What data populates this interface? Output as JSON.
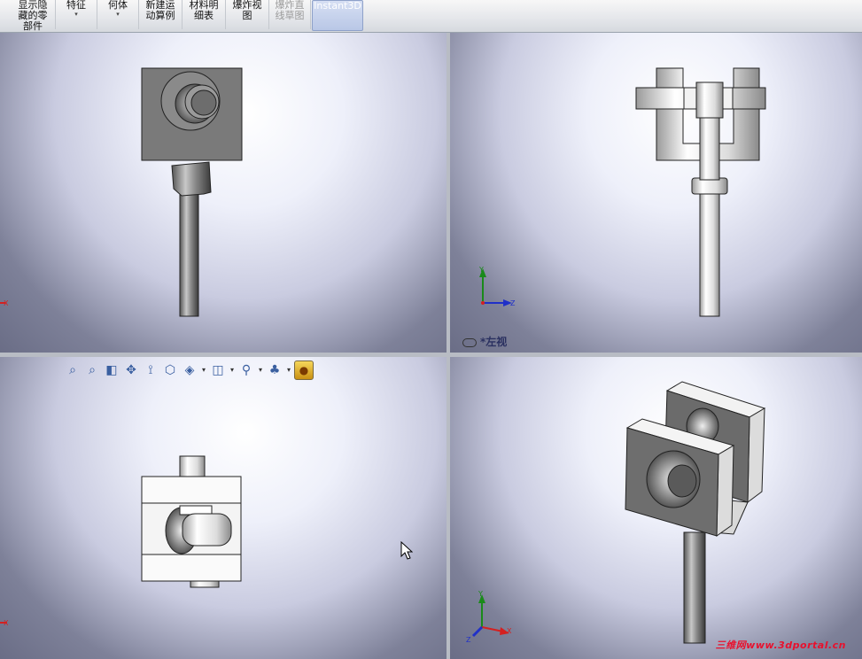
{
  "ribbon": {
    "buttons": [
      {
        "line1": "显示隐",
        "line2": "藏的零",
        "line3": "部件"
      },
      {
        "line1": "特征",
        "line2": "▾",
        "line3": ""
      },
      {
        "line1": "何体",
        "line2": "▾",
        "line3": ""
      },
      {
        "line1": "新建运",
        "line2": "动算例",
        "line3": ""
      },
      {
        "line1": "材料明",
        "line2": "细表",
        "line3": ""
      },
      {
        "line1": "爆炸视",
        "line2": "图",
        "line3": ""
      },
      {
        "line1": "爆炸直",
        "line2": "线草图",
        "line3": ""
      },
      {
        "line1": "Instant3D",
        "line2": "",
        "line3": ""
      }
    ]
  },
  "viewports": {
    "top_right_label": "*左视"
  },
  "axes": {
    "x": "X",
    "y": "Y",
    "z": "Z"
  },
  "watermark": "三维网www.3dportal.cn",
  "colors": {
    "ribbon_active": "#b9c7e6",
    "accent_red": "#e8112d",
    "axis_x": "#d42020",
    "axis_y": "#1a8a1a",
    "axis_z": "#2030c8"
  }
}
